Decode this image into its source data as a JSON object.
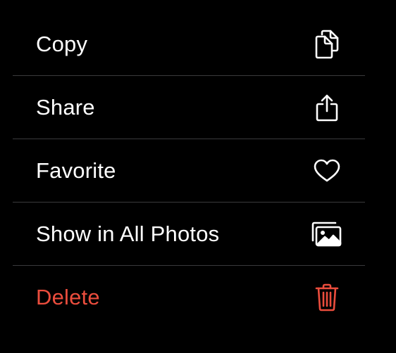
{
  "menu": {
    "items": [
      {
        "label": "Copy",
        "icon": "copy-icon",
        "destructive": false
      },
      {
        "label": "Share",
        "icon": "share-icon",
        "destructive": false
      },
      {
        "label": "Favorite",
        "icon": "heart-icon",
        "destructive": false
      },
      {
        "label": "Show in All Photos",
        "icon": "photos-icon",
        "destructive": false
      },
      {
        "label": "Delete",
        "icon": "trash-icon",
        "destructive": true
      }
    ]
  },
  "colors": {
    "background": "#000000",
    "text": "#ffffff",
    "destructive": "#eb4d3d",
    "divider": "#3a3a3c"
  }
}
